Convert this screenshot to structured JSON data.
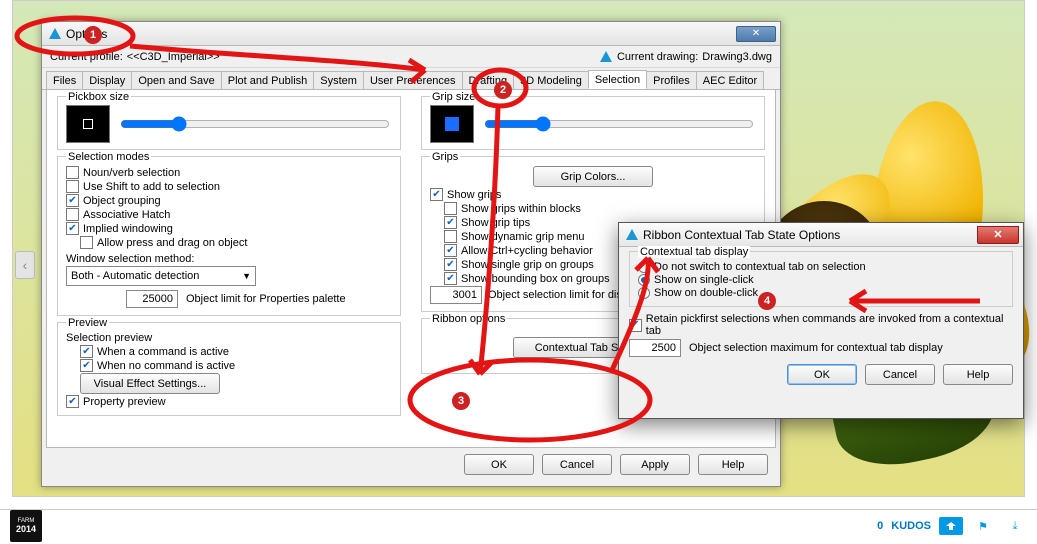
{
  "options": {
    "title": "Options",
    "profile_label": "Current profile:",
    "profile_value": "<<C3D_Imperial>>",
    "drawing_label": "Current drawing:",
    "drawing_value": "Drawing3.dwg",
    "tabs": [
      "Files",
      "Display",
      "Open and Save",
      "Plot and Publish",
      "System",
      "User Preferences",
      "Drafting",
      "3D Modeling",
      "Selection",
      "Profiles",
      "AEC Editor"
    ],
    "active_tab": "Selection",
    "pickbox_label": "Pickbox size",
    "gripsize_label": "Grip size",
    "selmodes": {
      "legend": "Selection modes",
      "noun_verb": "Noun/verb selection",
      "use_shift": "Use Shift to add to selection",
      "obj_group": "Object grouping",
      "assoc_hatch": "Associative Hatch",
      "implied_wind": "Implied windowing",
      "allow_press": "Allow press and drag on object",
      "win_sel_method": "Window selection method:",
      "win_sel_value": "Both - Automatic detection",
      "obj_limit_val": "25000",
      "obj_limit_label": "Object limit for Properties palette"
    },
    "preview": {
      "legend": "Preview",
      "sel_preview": "Selection preview",
      "when_cmd_active": "When a command is active",
      "when_no_cmd": "When no command is active",
      "vis_eff_btn": "Visual Effect Settings...",
      "prop_preview": "Property preview"
    },
    "grips": {
      "legend": "Grips",
      "colors_btn": "Grip Colors...",
      "show_grips": "Show grips",
      "within_blocks": "Show grips within blocks",
      "grip_tips": "Show grip tips",
      "dyn_menu": "Show dynamic grip menu",
      "ctrl_cycle": "Allow Ctrl+cycling behavior",
      "single_on_groups": "Show single grip on groups",
      "bbox_on_groups": "Show bounding box on groups",
      "obj_limit_val": "3001",
      "obj_limit_label": "Object selection limit for display of grips"
    },
    "ribbon_group": {
      "legend": "Ribbon options",
      "ctx_btn": "Contextual Tab States..."
    },
    "buttons": {
      "ok": "OK",
      "cancel": "Cancel",
      "apply": "Apply",
      "help": "Help"
    }
  },
  "ribbon": {
    "title": "Ribbon Contextual Tab State Options",
    "group_legend": "Contextual tab display",
    "opt_no_switch": "Do not switch to contextual tab on selection",
    "opt_single": "Show on single-click",
    "opt_double": "Show on double-click",
    "retain": "Retain pickfirst selections when commands are invoked from a contextual tab",
    "max_val": "2500",
    "max_label": "Object selection maximum for contextual tab display",
    "buttons": {
      "ok": "OK",
      "cancel": "Cancel",
      "help": "Help"
    }
  },
  "footer": {
    "kudos_count": "0",
    "kudos_label": "KUDOS"
  }
}
